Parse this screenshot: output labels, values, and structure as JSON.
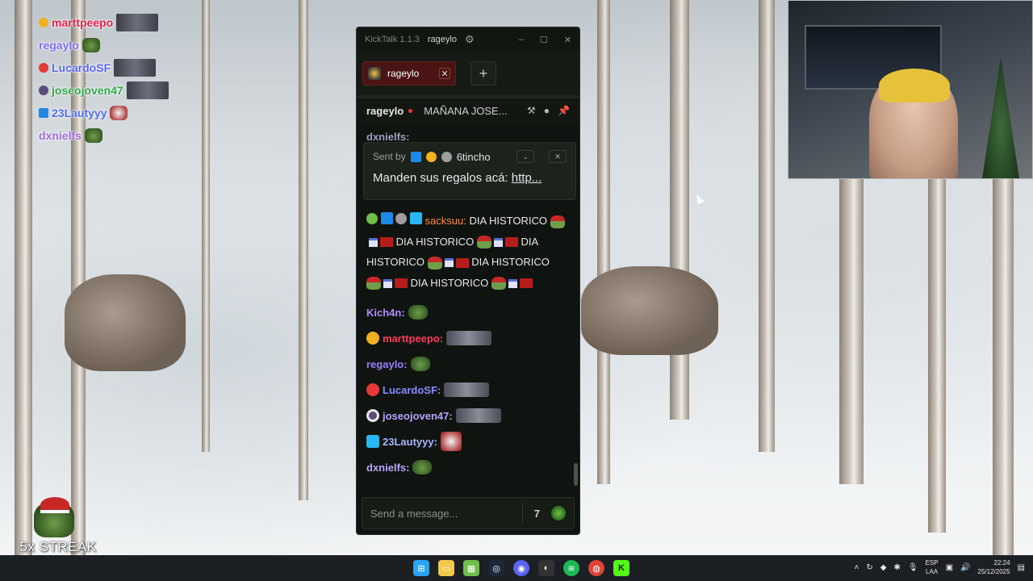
{
  "overlay_chat": [
    {
      "name": "marttpeepo",
      "color": "#e0204a"
    },
    {
      "name": "regaylo",
      "color": "#7c6cff"
    },
    {
      "name": "LucardoSF",
      "color": "#5b63ff"
    },
    {
      "name": "joseojoven47",
      "color": "#2ea84a"
    },
    {
      "name": "23Lautyyy",
      "color": "#4c6cf0"
    },
    {
      "name": "dxnielfs",
      "color": "#a06ad8"
    }
  ],
  "streak": {
    "text": "5x STREAK"
  },
  "window": {
    "app_title": "KickTalk 1.1.3",
    "user": "rageylo",
    "minimize": "–",
    "maximize": "☐",
    "close": "✕"
  },
  "tabs": [
    {
      "label": "rageylo",
      "close": "✕"
    }
  ],
  "add_tab_label": "+",
  "channel_header": {
    "channel": "rageylo",
    "stream_title": "MAÑANA JOSE..."
  },
  "pinned": {
    "sent_by_label": "Sent by",
    "sender": "6tincho",
    "message_text": "Manden sus regalos acá: ",
    "message_link": "http..."
  },
  "chat": {
    "cut_name": "dxnielfs:",
    "spam_user": "sacksuu:",
    "spam_user_color": "#ff8c42",
    "spam_lines": [
      "DIA HISTORICO",
      "DIA HISTORICO",
      "DIA HISTORICO",
      "DIA",
      "HISTORICO",
      "DIA",
      "HISTORICO"
    ],
    "messages": [
      {
        "user": "Kich4n:",
        "color": "#b28cff"
      },
      {
        "user": "marttpeepo:",
        "color": "#ff3b5c"
      },
      {
        "user": "regaylo:",
        "color": "#9a7dff"
      },
      {
        "user": "LucardoSF:",
        "color": "#8a8cff"
      },
      {
        "user": "joseojoven47:",
        "color": "#b9a4ff"
      },
      {
        "user": "23Lautyyy:",
        "color": "#a7b4ff"
      },
      {
        "user": "dxnielfs:",
        "color": "#b8a6ff"
      }
    ]
  },
  "input": {
    "placeholder": "Send a message..."
  },
  "taskbar": {
    "lang_top": "ESP",
    "lang_bottom": "LAA",
    "time": "22:24",
    "date": "25/12/2025"
  },
  "colors": {
    "kick_green": "#53fc18",
    "tab_red": "#4a1414"
  }
}
